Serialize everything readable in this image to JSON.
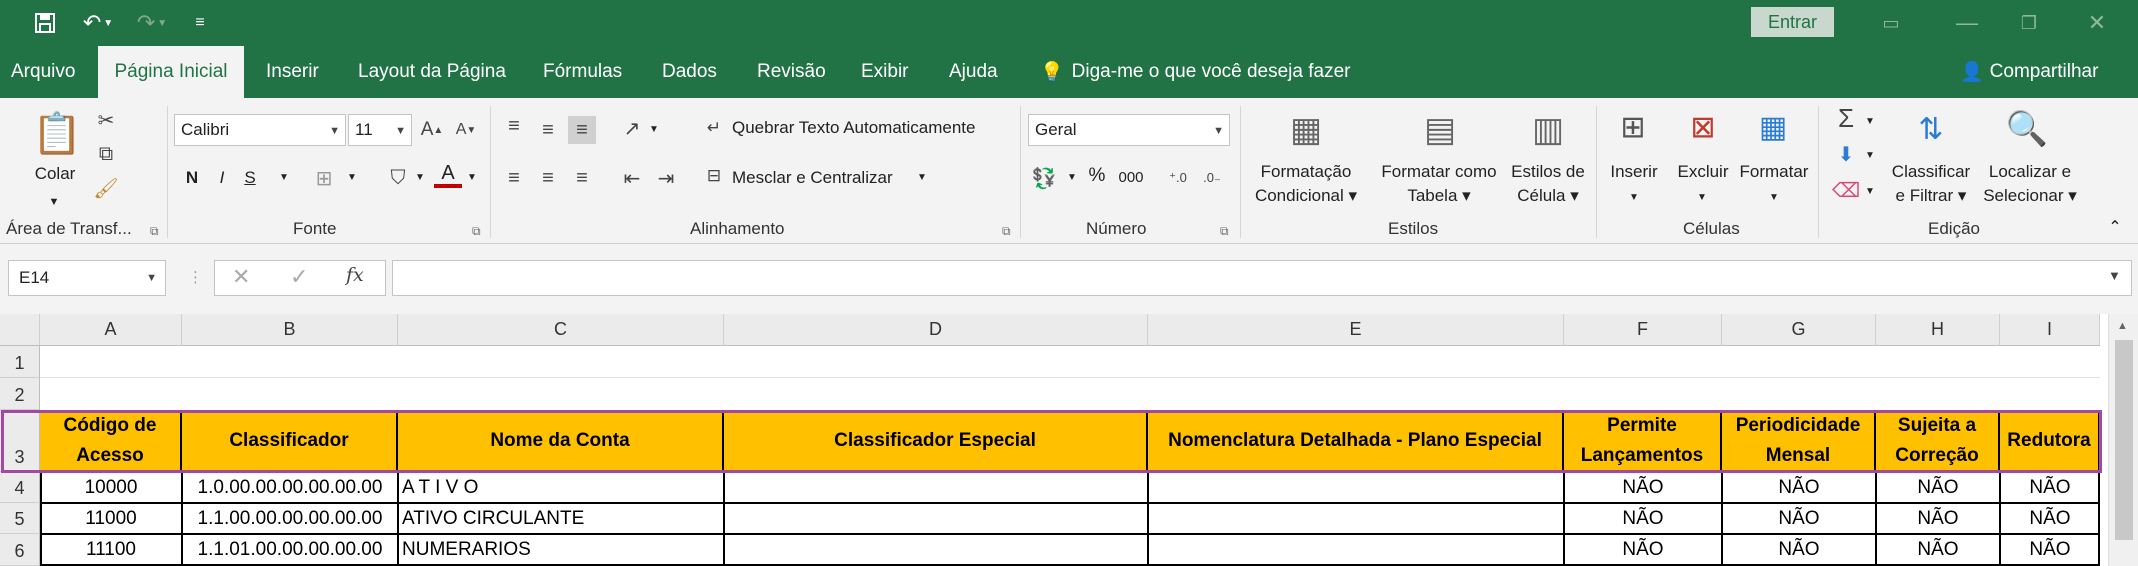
{
  "colors": {
    "brand": "#217346",
    "header_fill": "#ffc000",
    "selection": "#a349a4"
  },
  "titlebar": {
    "signin": "Entrar"
  },
  "tabs": [
    "Arquivo",
    "Página Inicial",
    "Inserir",
    "Layout da Página",
    "Fórmulas",
    "Dados",
    "Revisão",
    "Exibir",
    "Ajuda"
  ],
  "tell_me": "Diga-me o que você deseja fazer",
  "share": "Compartilhar",
  "ribbon": {
    "clipboard": {
      "paste": "Colar",
      "label": "Área de Transf..."
    },
    "font": {
      "name": "Calibri",
      "size": "11",
      "bold": "N",
      "italic": "I",
      "underline": "S",
      "label": "Fonte"
    },
    "alignment": {
      "wrap": "Quebrar Texto Automaticamente",
      "merge": "Mesclar e Centralizar",
      "label": "Alinhamento"
    },
    "number": {
      "format": "Geral",
      "percent": "%",
      "thousands": "000",
      "label": "Número"
    },
    "styles": {
      "cond1": "Formatação",
      "cond2": "Condicional",
      "table1": "Formatar como",
      "table2": "Tabela",
      "cell1": "Estilos de",
      "cell2": "Célula",
      "label": "Estilos"
    },
    "cells": {
      "insert": "Inserir",
      "delete": "Excluir",
      "format": "Formatar",
      "label": "Células"
    },
    "editing": {
      "sort1": "Classificar",
      "sort2": "e Filtrar",
      "find1": "Localizar e",
      "find2": "Selecionar",
      "label": "Edição"
    }
  },
  "formula_bar": {
    "name_box": "E14",
    "fx": "fx",
    "value": ""
  },
  "columns": [
    "A",
    "B",
    "C",
    "D",
    "E",
    "F",
    "G",
    "H",
    "I"
  ],
  "rows": [
    "1",
    "2",
    "3",
    "4",
    "5",
    "6"
  ],
  "headers": {
    "a": "Código de Acesso",
    "b": "Classificador",
    "c": "Nome da Conta",
    "d": "Classificador Especial",
    "e": "Nomenclatura Detalhada - Plano Especial",
    "f": "Permite Lançamentos",
    "g": "Periodicidade Mensal",
    "h": "Sujeita a Correção",
    "i": "Redutora"
  },
  "data": [
    {
      "a": "10000",
      "b": "1.0.00.00.00.00.00.00",
      "c": "A T I V O",
      "f": "NÃO",
      "g": "NÃO",
      "h": "NÃO",
      "i": "NÃO"
    },
    {
      "a": "11000",
      "b": "1.1.00.00.00.00.00.00",
      "c": "ATIVO CIRCULANTE",
      "f": "NÃO",
      "g": "NÃO",
      "h": "NÃO",
      "i": "NÃO"
    },
    {
      "a": "11100",
      "b": "1.1.01.00.00.00.00.00",
      "c": "NUMERARIOS",
      "f": "NÃO",
      "g": "NÃO",
      "h": "NÃO",
      "i": "NÃO"
    }
  ]
}
